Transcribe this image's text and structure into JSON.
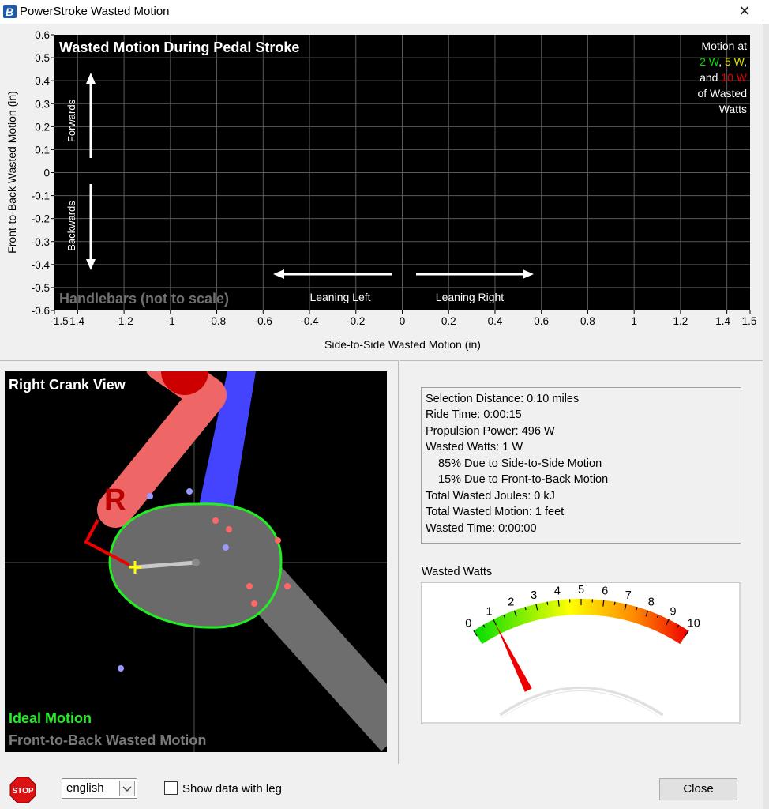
{
  "window": {
    "title": "PowerStroke Wasted Motion",
    "close_symbol": "✕"
  },
  "plot": {
    "title": "Wasted Motion During Pedal Stroke",
    "xlabel": "Side-to-Side Wasted Motion (in)",
    "ylabel": "Front-to-Back Wasted Motion (in)",
    "x_ticks": [
      "-1.5",
      "-1.4",
      "-1.2",
      "-1",
      "-0.8",
      "-0.6",
      "-0.4",
      "-0.2",
      "0",
      "0.2",
      "0.4",
      "0.6",
      "0.8",
      "1",
      "1.2",
      "1.4",
      "1.5"
    ],
    "y_ticks": [
      "0.6",
      "0.5",
      "0.4",
      "0.3",
      "0.2",
      "0.1",
      "0",
      "-0.1",
      "-0.2",
      "-0.3",
      "-0.4",
      "-0.5",
      "-0.6"
    ],
    "forwards": "Forwards",
    "backwards": "Backwards",
    "leaning_left": "Leaning Left",
    "leaning_right": "Leaning Right",
    "handlebars": "Handlebars (not to scale)",
    "legend": {
      "line1": "Motion at",
      "v2": "2 W",
      "v5": "5 W",
      "and": "and",
      "v10": "10 W",
      "line4": "of Wasted",
      "line5": "Watts",
      "color_2": "#00e000",
      "color_5": "#e0e000",
      "color_10": "#e00000"
    }
  },
  "chart_data": {
    "type": "scatter",
    "title": "Wasted Motion During Pedal Stroke",
    "xlabel": "Side-to-Side Wasted Motion (in)",
    "ylabel": "Front-to-Back Wasted Motion (in)",
    "xlim": [
      -1.5,
      1.5
    ],
    "ylim": [
      -0.6,
      0.6
    ],
    "grid": true,
    "series": []
  },
  "crank": {
    "title": "Right Crank View",
    "r_letter": "R",
    "ideal": "Ideal Motion",
    "front_back": "Front-to-Back Wasted Motion"
  },
  "stats": {
    "selection_distance": "Selection Distance: 0.10 miles",
    "ride_time": "Ride Time: 0:00:15",
    "propulsion": "Propulsion Power: 496 W",
    "wasted_watts": "Wasted Watts: 1 W",
    "side_pct": "85% Due to Side-to-Side Motion",
    "front_pct": "15% Due to Front-to-Back Motion",
    "joules": "Total Wasted Joules: 0 kJ",
    "motion": "Total Wasted Motion: 1 feet",
    "time": "Wasted Time: 0:00:00"
  },
  "gauge": {
    "label": "Wasted Watts",
    "min": 0,
    "max": 10,
    "value": 1,
    "ticks": [
      "0",
      "1",
      "2",
      "3",
      "4",
      "5",
      "6",
      "7",
      "8",
      "9",
      "10"
    ]
  },
  "footer": {
    "stop": "STOP",
    "language": "english",
    "show_leg": "Show data with leg",
    "close": "Close"
  }
}
